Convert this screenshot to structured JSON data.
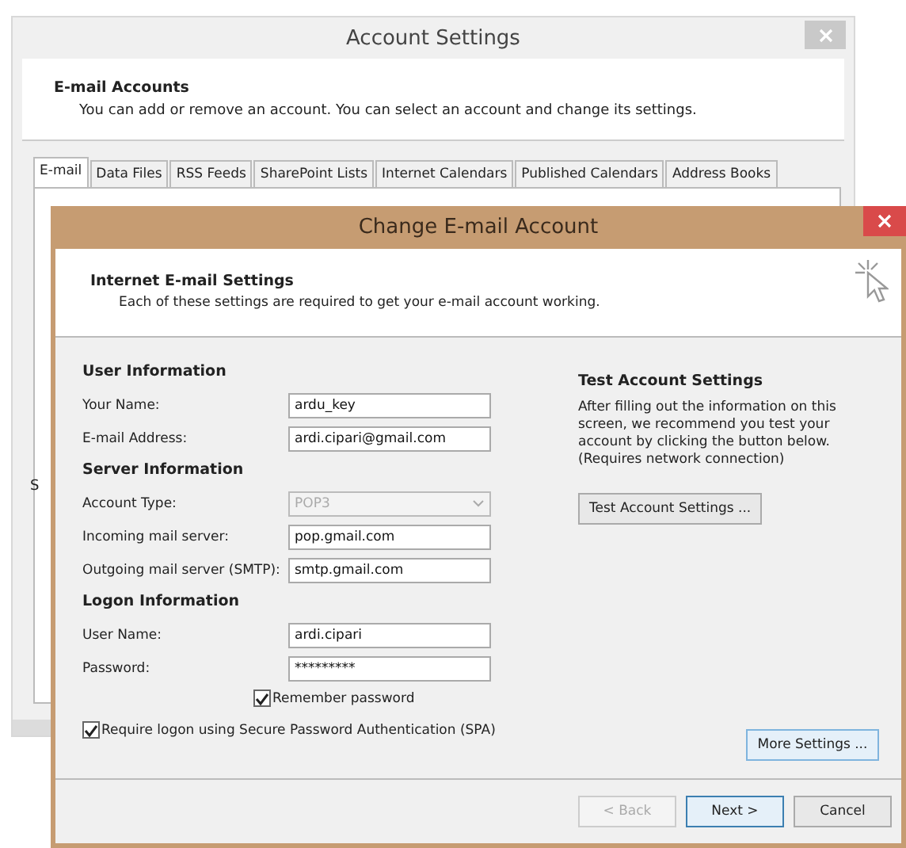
{
  "background_window": {
    "title": "Account Settings",
    "header": {
      "title": "E-mail Accounts",
      "subtitle": "You can add or remove an account. You can select an account and change its settings."
    },
    "tabs": [
      {
        "label": "E-mail",
        "selected": true
      },
      {
        "label": "Data Files",
        "selected": false
      },
      {
        "label": "RSS Feeds",
        "selected": false
      },
      {
        "label": "SharePoint Lists",
        "selected": false
      },
      {
        "label": "Internet Calendars",
        "selected": false
      },
      {
        "label": "Published Calendars",
        "selected": false
      },
      {
        "label": "Address Books",
        "selected": false
      }
    ],
    "partial_label": "S"
  },
  "dialog": {
    "title": "Change E-mail Account",
    "header": {
      "title": "Internet E-mail Settings",
      "subtitle": "Each of these settings are required to get your e-mail account working."
    },
    "sections": [
      {
        "title": "User Information",
        "fields": [
          {
            "label": "Your Name:",
            "value": "ardu_key",
            "kind": "text",
            "disabled": false
          },
          {
            "label": "E-mail Address:",
            "value": "ardi.cipari@gmail.com",
            "kind": "text",
            "disabled": false
          }
        ]
      },
      {
        "title": "Server Information",
        "fields": [
          {
            "label": "Account Type:",
            "value": "POP3",
            "kind": "select",
            "disabled": true
          },
          {
            "label": "Incoming mail server:",
            "value": "pop.gmail.com",
            "kind": "text",
            "disabled": false
          },
          {
            "label": "Outgoing mail server (SMTP):",
            "value": "smtp.gmail.com",
            "kind": "text",
            "disabled": false
          }
        ]
      },
      {
        "title": "Logon Information",
        "fields": [
          {
            "label": "User Name:",
            "value": "ardi.cipari",
            "kind": "text",
            "disabled": false
          },
          {
            "label": "Password:",
            "value": "*********",
            "kind": "text",
            "disabled": false
          }
        ]
      }
    ],
    "remember_password": {
      "label": "Remember password",
      "checked": true
    },
    "spa": {
      "label": "Require logon using Secure Password Authentication (SPA)",
      "checked": true
    },
    "test": {
      "title": "Test Account Settings",
      "description": "After filling out the information on this screen, we recommend you test your account by clicking the button below. (Requires network connection)",
      "button": "Test Account Settings ..."
    },
    "more_settings_button": "More Settings ...",
    "buttons": [
      {
        "label": "< Back",
        "disabled": true,
        "default": false
      },
      {
        "label": "Next >",
        "disabled": false,
        "default": true
      },
      {
        "label": "Cancel",
        "disabled": false,
        "default": false
      }
    ]
  }
}
